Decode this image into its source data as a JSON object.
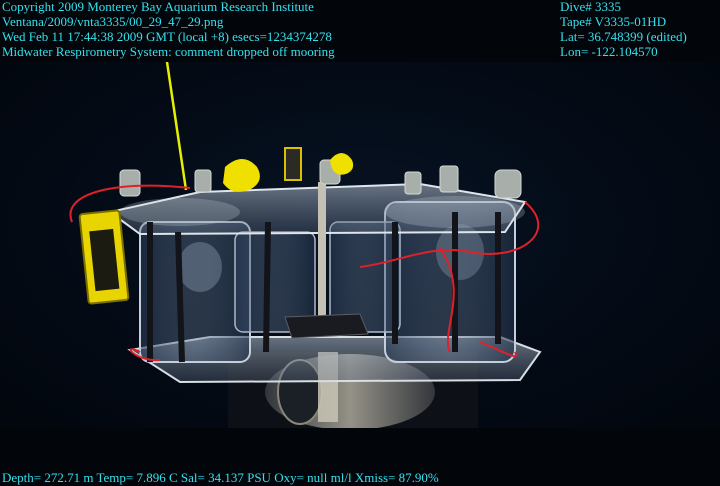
{
  "overlay": {
    "left": {
      "copyright": "Copyright 2009 Monterey Bay Aquarium Research Institute",
      "file_path": "Ventana/2009/vnta3335/00_29_47_29.png",
      "datetime": "Wed Feb 11 17:44:38 2009 GMT (local +8)  esecs=1234374278",
      "comment": "Midwater Respirometry System: comment dropped off mooring"
    },
    "right": {
      "dive": "Dive# 3335",
      "tape": "Tape# V3335-01HD",
      "lat": "Lat= 36.748399 (edited)",
      "lon": "Lon= -122.104570"
    },
    "bottom": {
      "telemetry": "Depth= 272.71 m  Temp= 7.896 C  Sal= 34.137 PSU  Oxy= null ml/l  Xmiss= 87.90%"
    }
  },
  "colors": {
    "overlay_text": "#35e0ee",
    "water": "#040c18",
    "tether": "#e4f000",
    "cable": "#e0202a",
    "housing": "#e8d400"
  }
}
